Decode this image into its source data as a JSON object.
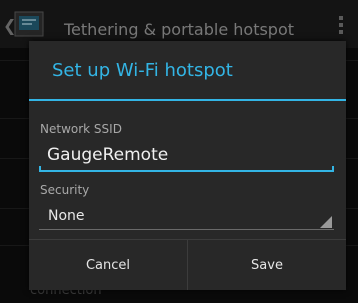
{
  "background": {
    "action_bar": {
      "back_glyph": "❮",
      "app_icon": "tethering-icon",
      "title": "Tethering & portable hotspot",
      "overflow_icon": "overflow-menu-icon"
    },
    "bottom_text": "connection"
  },
  "dialog": {
    "title": "Set up Wi-Fi hotspot",
    "ssid": {
      "label": "Network SSID",
      "value": "GaugeRemote"
    },
    "security": {
      "label": "Security",
      "selected": "None"
    },
    "buttons": {
      "cancel": "Cancel",
      "save": "Save"
    }
  },
  "colors": {
    "accent": "#33b5e5",
    "dialog_bg": "#282828",
    "text_primary": "#f0f0f0",
    "text_secondary": "#a8a8a8"
  }
}
